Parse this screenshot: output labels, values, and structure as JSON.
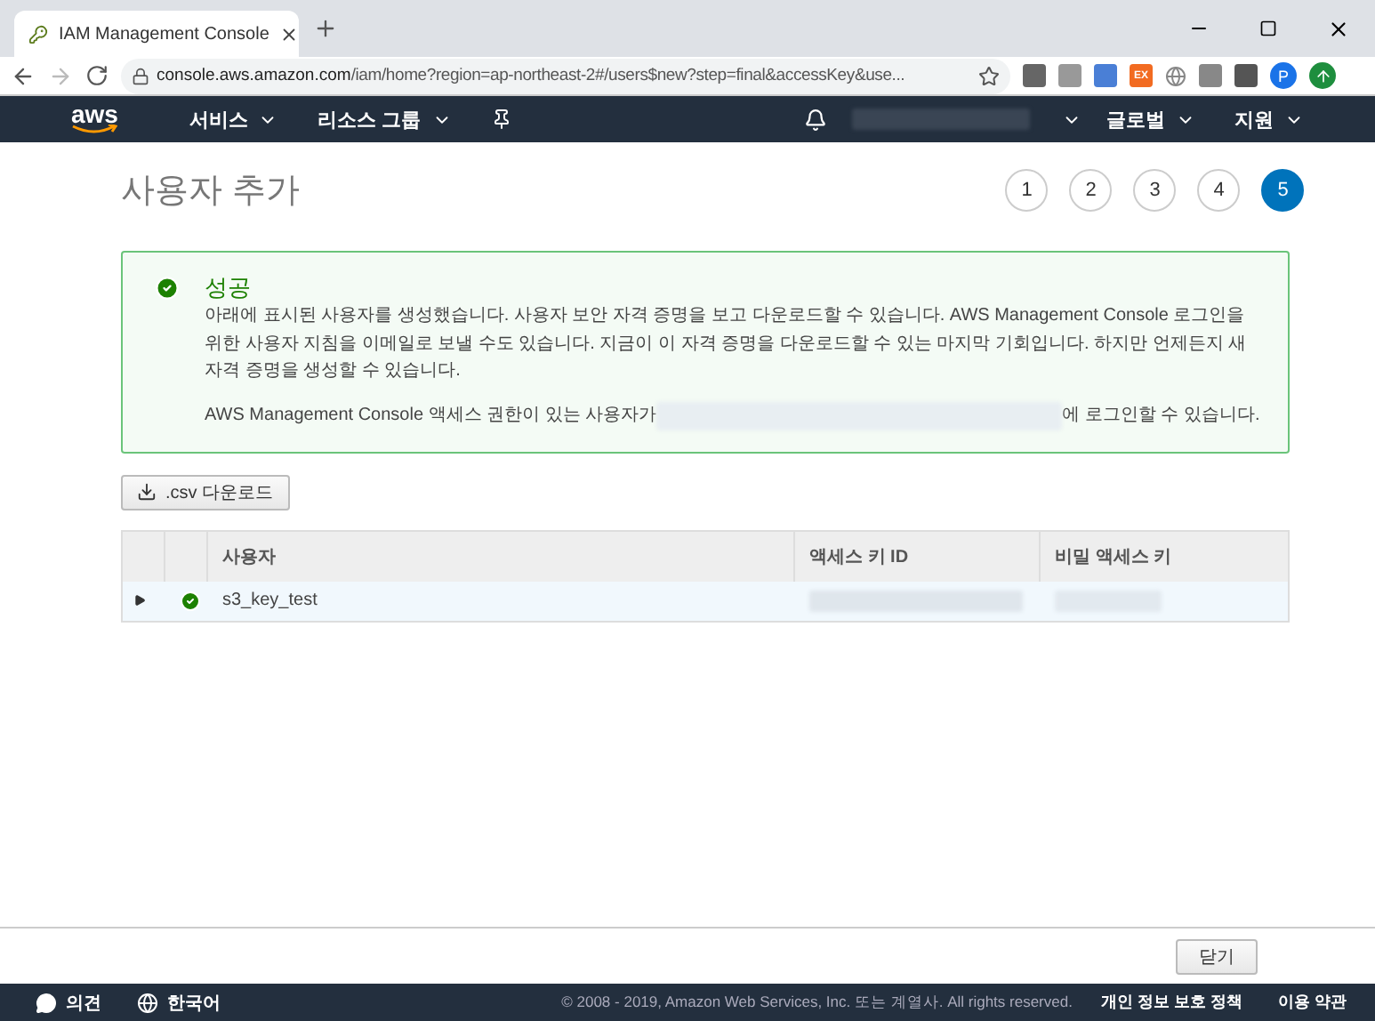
{
  "browser": {
    "tab_title": "IAM Management Console",
    "url_host": "console.aws.amazon.com",
    "url_path": "/iam/home?region=ap-northeast-2#/users$new?step=final&accessKey&use...",
    "extension_label": "EX",
    "profile_initial": "P"
  },
  "nav": {
    "logo": "aws",
    "items": [
      {
        "label": "서비스"
      },
      {
        "label": "리소스 그룹"
      }
    ],
    "region": "글로벌",
    "support": "지원"
  },
  "page": {
    "title": "사용자 추가",
    "steps": [
      {
        "label": "1",
        "selected": false
      },
      {
        "label": "2",
        "selected": false
      },
      {
        "label": "3",
        "selected": false
      },
      {
        "label": "4",
        "selected": false
      },
      {
        "label": "5",
        "selected": true
      }
    ]
  },
  "alert": {
    "title": "성공",
    "message": "아래에 표시된 사용자를 생성했습니다. 사용자 보안 자격 증명을 보고 다운로드할 수 있습니다. AWS Management Console 로그인을 위한 사용자 지침을 이메일로 보낼 수도 있습니다. 지금이 이 자격 증명을 다운로드할 수 있는 마지막 기회입니다. 하지만 언제든지 새 자격 증명을 생성할 수 있습니다.",
    "login_before": "AWS Management Console 액세스 권한이 있는 사용자가",
    "login_after": "에 로그인할 수 있습니다."
  },
  "download_button": ".csv 다운로드",
  "table": {
    "columns": [
      "사용자",
      "액세스 키 ID",
      "비밀 액세스 키"
    ],
    "rows": [
      {
        "user": "s3_key_test",
        "expanded": false,
        "success": true
      }
    ]
  },
  "close_button": "닫기",
  "footer": {
    "feedback": "의견",
    "language": "한국어",
    "copyright": "© 2008 - 2019, Amazon Web Services, Inc. 또는 계열사. All rights reserved.",
    "links": [
      "개인 정보 보호 정책",
      "이용 약관"
    ]
  }
}
